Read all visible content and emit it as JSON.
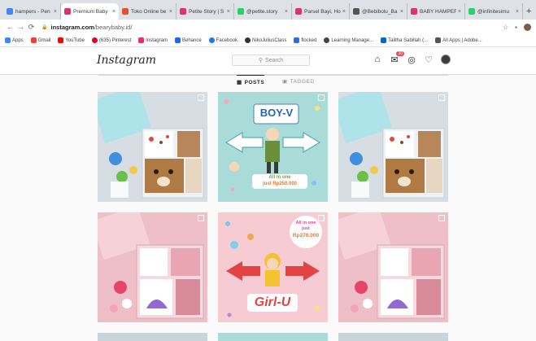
{
  "browser": {
    "tabs": [
      {
        "title": "hampers - Pen",
        "color": "#4285f4",
        "active": false
      },
      {
        "title": "Premium Baby",
        "color": "#e1306c",
        "active": true
      },
      {
        "title": "Toko Online be",
        "color": "#ee4d2d",
        "active": false
      },
      {
        "title": "Petite Story | S",
        "color": "#e1306c",
        "active": false
      },
      {
        "title": "@petite.story",
        "color": "#25d366",
        "active": false
      },
      {
        "title": "Parsel Bayi, Ho",
        "color": "#e1306c",
        "active": false
      },
      {
        "title": "@Bebibolu_Ba",
        "color": "#555555",
        "active": false
      },
      {
        "title": "BABY HAMPER",
        "color": "#e1306c",
        "active": false
      },
      {
        "title": "@infinitesimu",
        "color": "#25d366",
        "active": false
      }
    ],
    "new_tab": "+",
    "close_glyph": "×",
    "url_host": "instagram.com",
    "url_path": "/bearybaby.id/",
    "bookmarks": [
      {
        "label": "Apps",
        "color": "#4285f4"
      },
      {
        "label": "Gmail",
        "color": "#ea4335"
      },
      {
        "label": "YouTube",
        "color": "#ff0000"
      },
      {
        "label": "(635) Pinterest",
        "color": "#e60023"
      },
      {
        "label": "Instagram",
        "color": "#e1306c"
      },
      {
        "label": "Behance",
        "color": "#1769ff"
      },
      {
        "label": "Facebook",
        "color": "#1877f2"
      },
      {
        "label": "NikoJuliusClass",
        "color": "#333333"
      },
      {
        "label": "flocked",
        "color": "#2d6cdf"
      },
      {
        "label": "Learning Manage...",
        "color": "#444444"
      },
      {
        "label": "Talitha Sabillah (...",
        "color": "#0a66c2"
      },
      {
        "label": "All Apps | Adobe...",
        "color": "#555555"
      }
    ]
  },
  "instagram": {
    "logo": "Instagram",
    "search_placeholder": "Search",
    "notification_count": "20",
    "tabs": {
      "posts": "POSTS",
      "tagged": "TAGGED"
    }
  },
  "posts": [
    {
      "kind": "photo-blue",
      "text": ""
    },
    {
      "kind": "boy",
      "title": "BOY-V",
      "caption_line1": "All in one",
      "caption_line2": "just Rp250.000"
    },
    {
      "kind": "photo-blue",
      "text": ""
    },
    {
      "kind": "photo-pink",
      "text": ""
    },
    {
      "kind": "girl",
      "title": "Girl-U",
      "caption_line1": "All in one",
      "caption_line2": "just",
      "caption_line3": "Rp270.000"
    },
    {
      "kind": "photo-pink",
      "text": ""
    }
  ],
  "colors": {
    "ig_accent": "#e1306c",
    "boy_bg": "#a9dcd9",
    "girl_bg": "#f7cbd2",
    "photo_blue_bg": "#d6dde3",
    "photo_pink_bg": "#efbfc7"
  }
}
